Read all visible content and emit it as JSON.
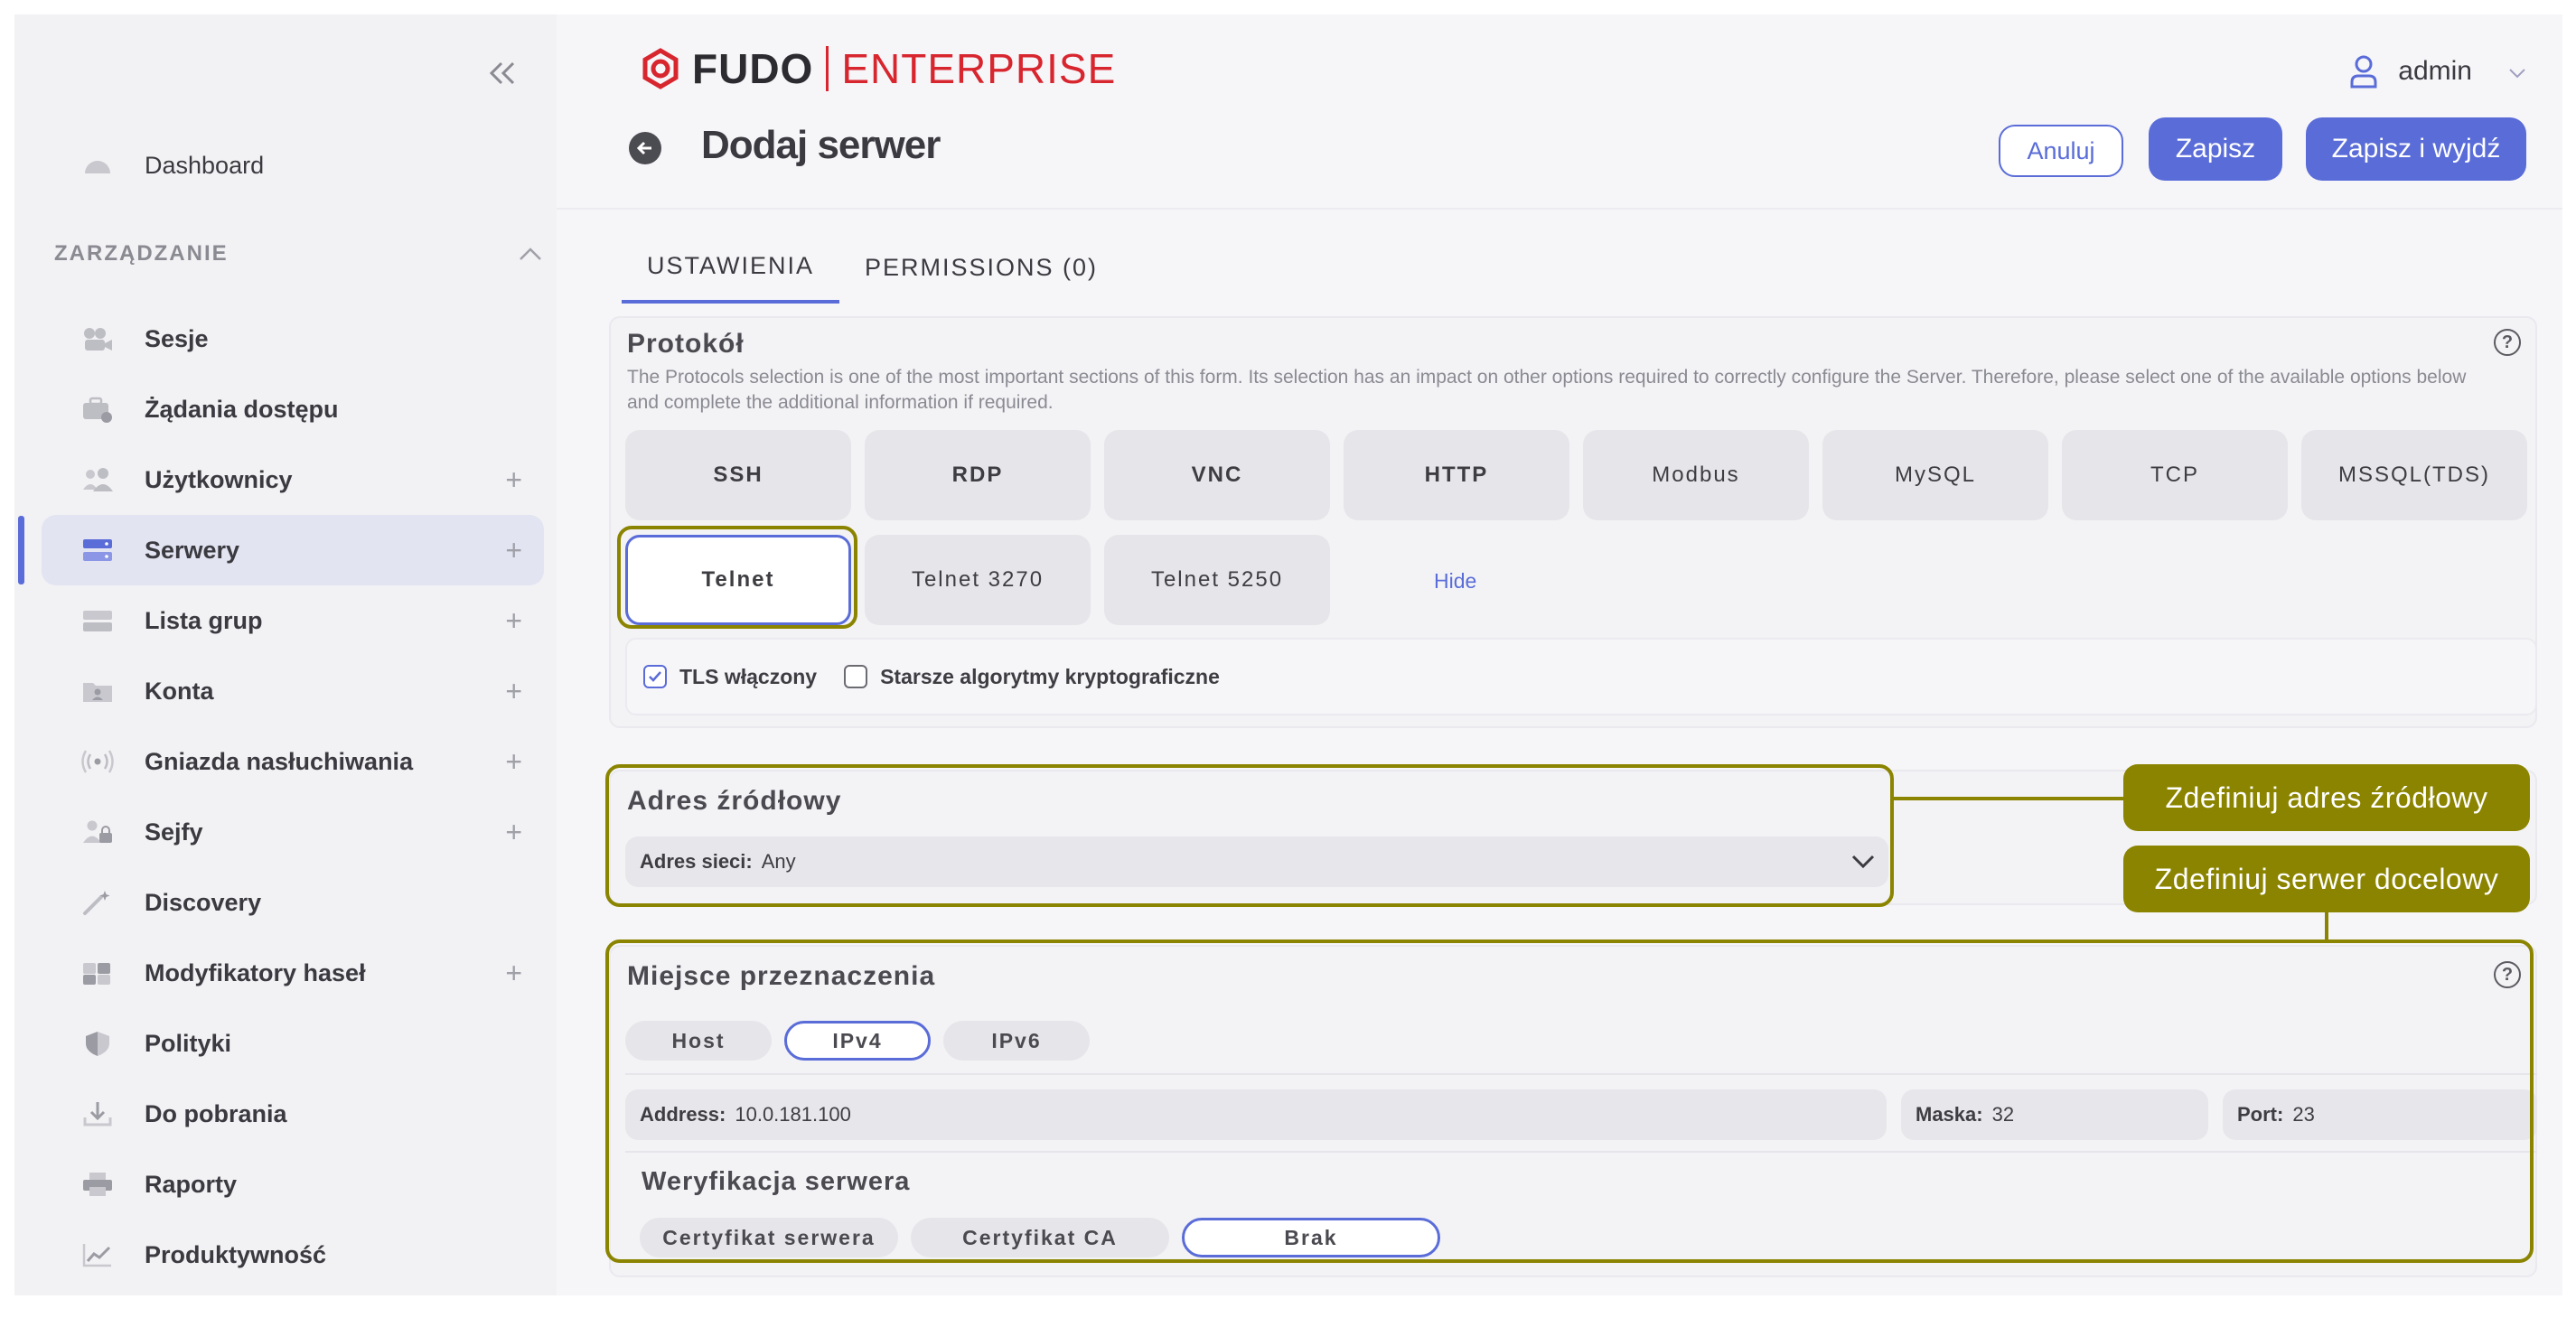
{
  "sidebar": {
    "dashboard": "Dashboard",
    "section": "ZARZĄDZANIE",
    "items": [
      {
        "label": "Sesje",
        "plus": ""
      },
      {
        "label": "Żądania dostępu",
        "plus": ""
      },
      {
        "label": "Użytkownicy",
        "plus": "+"
      },
      {
        "label": "Serwery",
        "plus": "+"
      },
      {
        "label": "Lista grup",
        "plus": "+"
      },
      {
        "label": "Konta",
        "plus": "+"
      },
      {
        "label": "Gniazda nasłuchiwania",
        "plus": "+"
      },
      {
        "label": "Sejfy",
        "plus": "+"
      },
      {
        "label": "Discovery",
        "plus": ""
      },
      {
        "label": "Modyfikatory haseł",
        "plus": "+"
      },
      {
        "label": "Polityki",
        "plus": ""
      },
      {
        "label": "Do pobrania",
        "plus": ""
      },
      {
        "label": "Raporty",
        "plus": ""
      },
      {
        "label": "Produktywność",
        "plus": ""
      }
    ]
  },
  "header": {
    "logo_fudo": "FUDO",
    "logo_enterprise": "ENTERPRISE",
    "user": "admin",
    "title": "Dodaj serwer",
    "cancel": "Anuluj",
    "save": "Zapisz",
    "save_exit": "Zapisz i wyjdź"
  },
  "tabs": [
    "USTAWIENIA",
    "PERMISSIONS (0)"
  ],
  "protocol": {
    "title": "Protokół",
    "description": "The Protocols selection is one of the most important sections of this form. Its selection has an impact on other options required to correctly configure the Server. Therefore, please select one of the available options below and complete the additional information if required.",
    "row1": [
      "SSH",
      "RDP",
      "VNC",
      "HTTP",
      "Modbus",
      "MySQL",
      "TCP",
      "MSSQL(TDS)"
    ],
    "row2": [
      "Telnet",
      "Telnet 3270",
      "Telnet 5250"
    ],
    "hide": "Hide",
    "tls": "TLS włączony",
    "legacy": "Starsze algorytmy kryptograficzne"
  },
  "source": {
    "title": "Adres źródłowy",
    "label": "Adres sieci:",
    "value": "Any"
  },
  "destination": {
    "title": "Miejsce przeznaczenia",
    "modes": [
      "Host",
      "IPv4",
      "IPv6"
    ],
    "address_label": "Address:",
    "address": "10.0.181.100",
    "mask_label": "Maska:",
    "mask": "32",
    "port_label": "Port:",
    "port": "23",
    "verification_title": "Weryfikacja serwera",
    "verification": [
      "Certyfikat serwera",
      "Certyfikat CA",
      "Brak"
    ]
  },
  "callouts": {
    "source": "Zdefiniuj adres źródłowy",
    "destination": "Zdefiniuj serwer docelowy"
  },
  "colors": {
    "accent": "#5a6cd8",
    "annotation": "#8b8400",
    "brand_red": "#d8262f"
  }
}
